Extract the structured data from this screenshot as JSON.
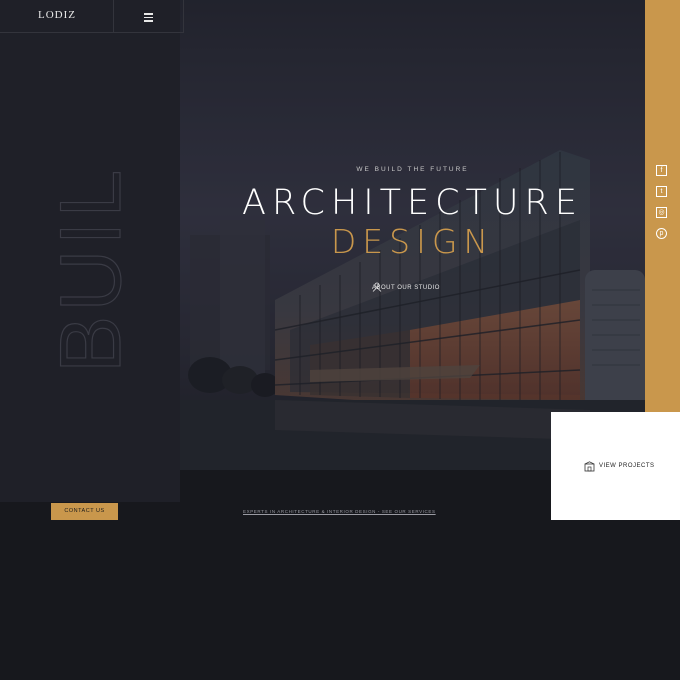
{
  "header": {
    "logo": "LODIZ",
    "menu_icon": "hamburger-icon"
  },
  "side_word": "BUILD",
  "hero": {
    "eyebrow": "WE BUILD THE FUTURE",
    "title_line1": "ARCHITECTURE",
    "title_line2": "DESIGN",
    "about_link": "ABOUT OUR STUDIO",
    "about_icon": "person-icon"
  },
  "social": [
    {
      "icon": "facebook-icon",
      "glyph": "f"
    },
    {
      "icon": "twitter-icon",
      "glyph": "t"
    },
    {
      "icon": "instagram-icon",
      "glyph": "◎"
    },
    {
      "icon": "pinterest-icon",
      "glyph": "p"
    }
  ],
  "view_projects": {
    "label": "VIEW PROJECTS",
    "icon": "building-icon"
  },
  "footer": {
    "contact_button": "CONTACT US",
    "experts_text": "EXPERTS IN ARCHITECTURE & INTERIOR DESIGN - SEE OUR SERVICES"
  },
  "colors": {
    "accent": "#c9974c",
    "dark": "#1f2028",
    "background": "#17181d",
    "white": "#ffffff"
  }
}
